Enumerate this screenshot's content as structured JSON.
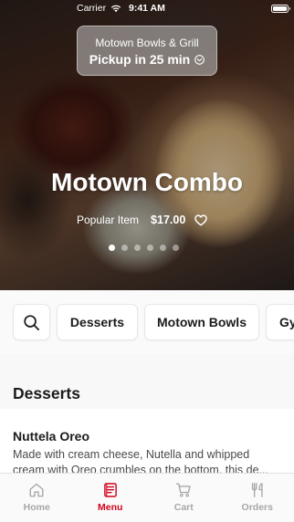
{
  "status_bar": {
    "carrier": "Carrier",
    "time": "9:41 AM"
  },
  "pickup": {
    "store_name": "Motown Bowls & Grill",
    "pickup_text": "Pickup in 25 min"
  },
  "hero": {
    "title": "Motown Combo",
    "tag": "Popular Item",
    "price": "$17.00",
    "carousel_dots": 6,
    "active_dot": 1
  },
  "categories": {
    "chips": [
      "Desserts",
      "Motown Bowls",
      "Gyros"
    ]
  },
  "section": {
    "title": "Desserts"
  },
  "menu_items": [
    {
      "name": "Nuttela Oreo",
      "description": "Made with cream cheese, Nutella and whipped cream with Oreo crumbles on the bottom, this de..."
    }
  ],
  "tabs": [
    {
      "label": "Home",
      "icon": "home-icon"
    },
    {
      "label": "Menu",
      "icon": "menu-icon"
    },
    {
      "label": "Cart",
      "icon": "cart-icon"
    },
    {
      "label": "Orders",
      "icon": "fork-knife-icon"
    }
  ],
  "active_tab": "Menu",
  "colors": {
    "accent": "#d0021b",
    "tab_inactive": "#a7a7a7"
  }
}
